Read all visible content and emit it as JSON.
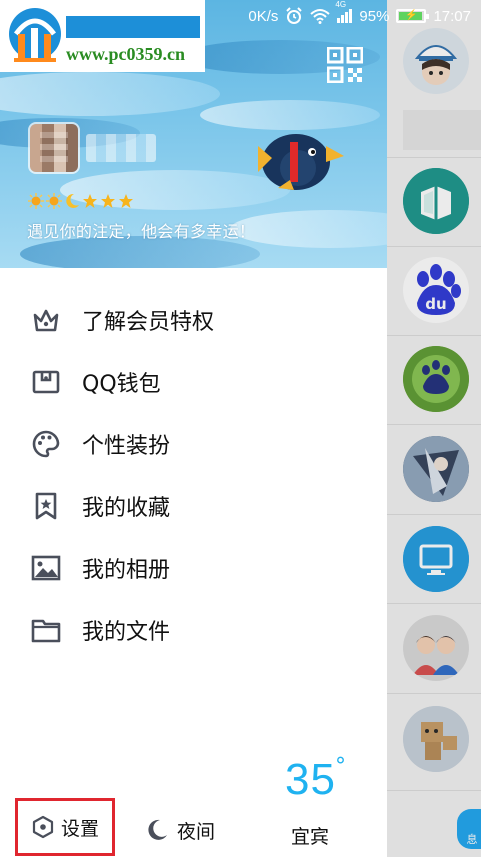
{
  "status_bar": {
    "speed": "0K/s",
    "network": "4G",
    "battery": "95%",
    "time": "17:07"
  },
  "watermark": {
    "text": "www.pc0359.cn"
  },
  "profile": {
    "signature": "遇见你的注定，他会有多幸运！",
    "level_icons": [
      "sun-icon",
      "sun-icon",
      "moon-icon",
      "star-icon",
      "star-icon",
      "star-icon"
    ]
  },
  "menu": {
    "items": [
      {
        "label": "了解会员特权",
        "icon": "crown-icon"
      },
      {
        "label": "QQ钱包",
        "icon": "wallet-icon"
      },
      {
        "label": "个性装扮",
        "icon": "palette-icon"
      },
      {
        "label": "我的收藏",
        "icon": "bookmark-star-icon"
      },
      {
        "label": "我的相册",
        "icon": "image-icon"
      },
      {
        "label": "我的文件",
        "icon": "folder-icon"
      }
    ]
  },
  "bottom": {
    "settings_label": "设置",
    "night_label": "夜间",
    "weather_temp": "35",
    "weather_degree": "°",
    "weather_city": "宜宾"
  },
  "backdrop": {
    "tab_partial_label": "息"
  },
  "colors": {
    "accent": "#1fb2f0",
    "highlight_border": "#e0262f",
    "icon_gray": "#4a4f5b"
  }
}
